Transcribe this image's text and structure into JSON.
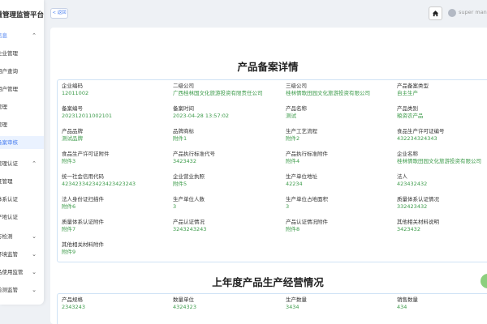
{
  "sidebar": {
    "title": "质量管理监管平台",
    "items": [
      {
        "label": "信息",
        "chev": "⌃",
        "blue": true
      },
      {
        "label": "企业管理"
      },
      {
        "label": "用户查询"
      },
      {
        "label": "用户管理"
      },
      {
        "label": "管理"
      },
      {
        "label": "管理"
      },
      {
        "label": "备案审核",
        "active": true
      },
      {
        "label": "管理认证",
        "chev": "⌃"
      },
      {
        "label": "证管理"
      },
      {
        "label": "体系认证"
      },
      {
        "label": "产地认证"
      },
      {
        "label": "方检测",
        "chev": "⌄"
      },
      {
        "label": "环境监管",
        "chev": "⌄"
      },
      {
        "label": "品使用监管",
        "chev": "⌄"
      },
      {
        "label": "检测监管",
        "chev": "⌄"
      }
    ]
  },
  "header": {
    "back_label": "< 返回",
    "user_name": "super manager"
  },
  "product_section": {
    "title": "产品备案详情",
    "fields": [
      {
        "label": "企业编码",
        "value": "12011002"
      },
      {
        "label": "二级公司",
        "value": "广西桂林国文化旅游投资有限责任公司"
      },
      {
        "label": "三级公司",
        "value": "桂林情歌田园文化旅游投资有限公司"
      },
      {
        "label": "产品备案类型",
        "value": "自主生产"
      },
      {
        "label": "备案编号",
        "value": "202312011002101"
      },
      {
        "label": "备案时间",
        "value": "2023-04-28 13:57:02"
      },
      {
        "label": "产品名称",
        "value": "测试"
      },
      {
        "label": "产品类别",
        "value": "粮资农产品"
      },
      {
        "label": "产品品牌",
        "value": "测试品牌"
      },
      {
        "label": "品牌商标",
        "value": "附件1"
      },
      {
        "label": "生产工艺流程",
        "value": "附件2"
      },
      {
        "label": "食品生产许可证编号",
        "value": "432234324343"
      },
      {
        "label": "食品生产许可证附件",
        "value": "附件3"
      },
      {
        "label": "产品执行标准代号",
        "value": "3423432"
      },
      {
        "label": "产品执行标准附件",
        "value": "附件4"
      },
      {
        "label": "企业名称",
        "value": "桂林情歌田园文化旅游投资有限公司"
      },
      {
        "label": "统一社会信用代码",
        "value": "4234233423423423423243"
      },
      {
        "label": "企业营业执照",
        "value": "附件5"
      },
      {
        "label": "生产单位地址",
        "value": "42234"
      },
      {
        "label": "法人",
        "value": "423432432"
      },
      {
        "label": "法人身份证扫描件",
        "value": "附件6"
      },
      {
        "label": "生产单位人数",
        "value": "3"
      },
      {
        "label": "生产单位占地面积",
        "value": "3"
      },
      {
        "label": "质量体系认证情况",
        "value": "332423432"
      },
      {
        "label": "质量体系认证附件",
        "value": "附件7"
      },
      {
        "label": "产品认证情况",
        "value": "3243243243"
      },
      {
        "label": "产品认证情况附件",
        "value": "附件8"
      },
      {
        "label": "其他相关材料说明",
        "value": "3423432"
      },
      {
        "label": "其他相关材料附件",
        "value": "附件9"
      }
    ]
  },
  "production_section": {
    "title": "上年度产品生产经营情况",
    "fields": [
      {
        "label": "产品规格",
        "value": "2343243"
      },
      {
        "label": "数量单位",
        "value": "4324323"
      },
      {
        "label": "生产数量",
        "value": "3434"
      },
      {
        "label": "销售数量",
        "value": "434"
      }
    ]
  }
}
